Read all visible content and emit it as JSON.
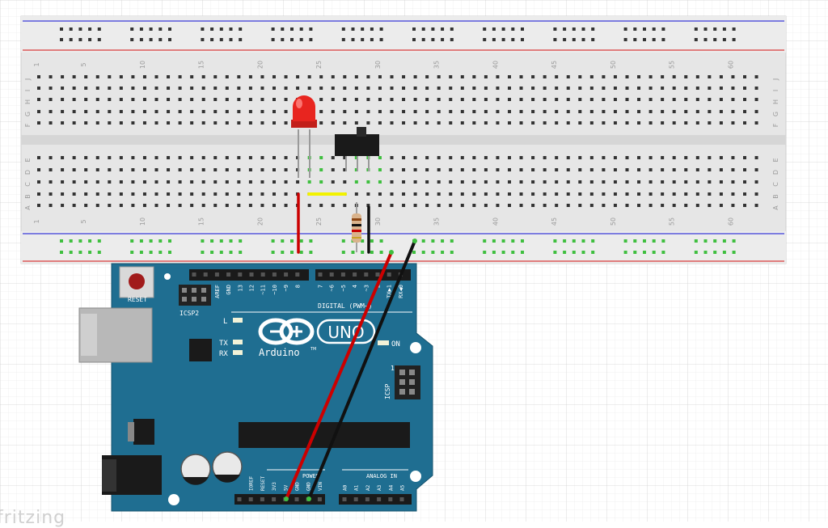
{
  "breadboard": {
    "column_numbers": [
      "1",
      "5",
      "10",
      "15",
      "20",
      "25",
      "30",
      "35",
      "40",
      "45",
      "50",
      "55",
      "60"
    ],
    "row_letters_top": [
      "J",
      "I",
      "H",
      "G",
      "F"
    ],
    "row_letters_bottom": [
      "E",
      "D",
      "C",
      "B",
      "A"
    ]
  },
  "arduino": {
    "reset_label": "RESET",
    "icsp2_label": "ICSP2",
    "icsp_label": "ICSP",
    "digital_label": "DIGITAL (PWM~)",
    "digital_pins": [
      "AREF",
      "GND",
      "13",
      "12",
      "~11",
      "~10",
      "~9",
      "8",
      "7",
      "~6",
      "~5",
      "4",
      "~3",
      "2",
      "TX▶1",
      "RX◀0"
    ],
    "led_labels": {
      "l": "L",
      "tx": "TX",
      "rx": "RX",
      "on": "ON"
    },
    "brand": "Arduino",
    "trademark": "TM",
    "uno_label": "UNO",
    "power_label": "POWER",
    "power_pins": [
      "IOREF",
      "RESET",
      "3V3",
      "5V",
      "GND",
      "GND",
      "VIN"
    ],
    "analog_label": "ANALOG IN",
    "analog_pins": [
      "A0",
      "A1",
      "A2",
      "A3",
      "A4",
      "A5"
    ],
    "one_label": "1"
  },
  "watermark": "fritzing",
  "colors": {
    "board_blue": "#1f6e91",
    "breadboard": "#e8e8e8",
    "wire_red": "#cc0000",
    "wire_black": "#111111",
    "wire_yellow": "#f2f200",
    "led_red": "#e8251f",
    "rail_blue": "#3b3bd8",
    "rail_red": "#d83b3b"
  }
}
